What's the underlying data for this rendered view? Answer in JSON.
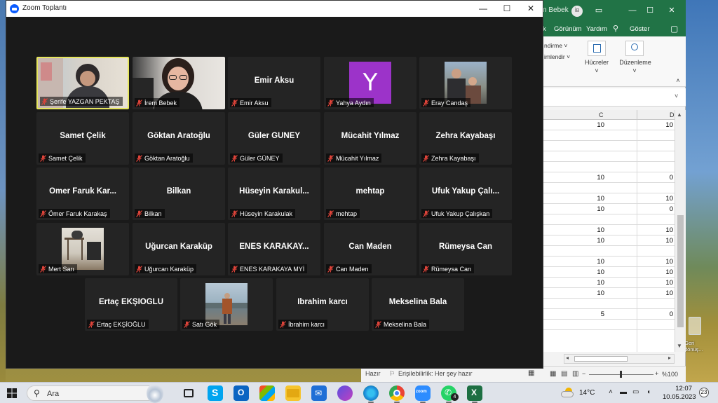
{
  "zoom": {
    "title": "Zoom Toplantı",
    "window_buttons": [
      "—",
      "☐",
      "✕"
    ],
    "participants": [
      {
        "display": "",
        "label": "Şerife YAZGAN PEKTAŞ",
        "video": "woman-headscarf",
        "active": true
      },
      {
        "display": "",
        "label": "İrem Bebek",
        "video": "woman-glasses"
      },
      {
        "display": "Emir Aksu",
        "label": "Emir Aksu"
      },
      {
        "display": "",
        "label": "Yahya Aydın",
        "avatar": "Y"
      },
      {
        "display": "",
        "label": "Eray Candaş",
        "video": "photo-couple"
      },
      {
        "display": "Samet Çelik",
        "label": "Samet Çelik"
      },
      {
        "display": "Göktan Aratoğlu",
        "label": "Göktan Aratoğlu"
      },
      {
        "display": "Güler GÜNEY",
        "label": "Güler GÜNEY"
      },
      {
        "display": "Mücahit Yılmaz",
        "label": "Mücahit Yılmaz"
      },
      {
        "display": "Zehra Kayabaşı",
        "label": "Zehra Kayabaşı"
      },
      {
        "display": "Ömer Faruk Kar...",
        "label": "Ömer Faruk Karakaş"
      },
      {
        "display": "Bilkan",
        "label": "Bilkan"
      },
      {
        "display": "Hüseyin Karakul...",
        "label": "Hüseyin Karakulak"
      },
      {
        "display": "mehtap",
        "label": "mehtap"
      },
      {
        "display": "Ufuk Yakup Çalı...",
        "label": "Ufuk Yakup Çalışkan"
      },
      {
        "display": "",
        "label": "Mert Sarı",
        "video": "photo-desk"
      },
      {
        "display": "Uğurcan Karaküp",
        "label": "Uğurcan Karaküp"
      },
      {
        "display": "ENES KARAKAY...",
        "label": "ENES KARAKAYA MYİ"
      },
      {
        "display": "Can Maden",
        "label": "Can Maden"
      },
      {
        "display": "Rümeysa Can",
        "label": "Rümeysa Can"
      },
      {
        "display": "Ertaç EKŞİOĞLU",
        "label": "Ertaç EKŞİOĞLU"
      },
      {
        "display": "",
        "label": "Satı Gök",
        "video": "photo-beach"
      },
      {
        "display": "İbrahim karcı",
        "label": "İbrahim karcı"
      },
      {
        "display": "Mekselina Bala",
        "label": "Mekselina Bala"
      }
    ]
  },
  "excel": {
    "user_name": "n Bebek",
    "user_initials": "İB",
    "menus": [
      "k",
      "Görünüm",
      "Yardım",
      "Göster"
    ],
    "ribbon": {
      "item1": "ndirme ˅",
      "item2": "imlendir ˅",
      "cells_label": "Hücreler",
      "edit_label": "Düzenleme"
    },
    "columns": [
      "C",
      "D"
    ],
    "rows": [
      {
        "c": "10",
        "d": "10"
      },
      {
        "c": "",
        "d": ""
      },
      {
        "c": "",
        "d": ""
      },
      {
        "c": "",
        "d": ""
      },
      {
        "c": "",
        "d": ""
      },
      {
        "c": "10",
        "d": "0"
      },
      {
        "c": "",
        "d": ""
      },
      {
        "c": "10",
        "d": "10"
      },
      {
        "c": "10",
        "d": "0"
      },
      {
        "c": "",
        "d": ""
      },
      {
        "c": "10",
        "d": "10"
      },
      {
        "c": "10",
        "d": "10"
      },
      {
        "c": "",
        "d": ""
      },
      {
        "c": "10",
        "d": "10"
      },
      {
        "c": "10",
        "d": "10"
      },
      {
        "c": "10",
        "d": "10"
      },
      {
        "c": "10",
        "d": "10"
      },
      {
        "c": "",
        "d": ""
      },
      {
        "c": "5",
        "d": "0"
      },
      {
        "c": "",
        "d": ""
      }
    ],
    "status_ready": "Hazır",
    "status_accessibility": "Erişilebilirlik: Her şey hazır",
    "zoom_level": "%100"
  },
  "desktop": {
    "icon_label": "Geri dönüş..."
  },
  "taskbar": {
    "search_placeholder": "Ara",
    "temperature": "14°C",
    "time": "12:07",
    "date": "10.05.2023",
    "notification_count": "23",
    "whatsapp_badge": "4"
  },
  "colors": {
    "zoom_bg": "#1a1a1a",
    "tile_bg": "#242424",
    "active_speaker": "#e5e55e",
    "excel_green": "#217346",
    "muted_red": "#e0443a"
  }
}
